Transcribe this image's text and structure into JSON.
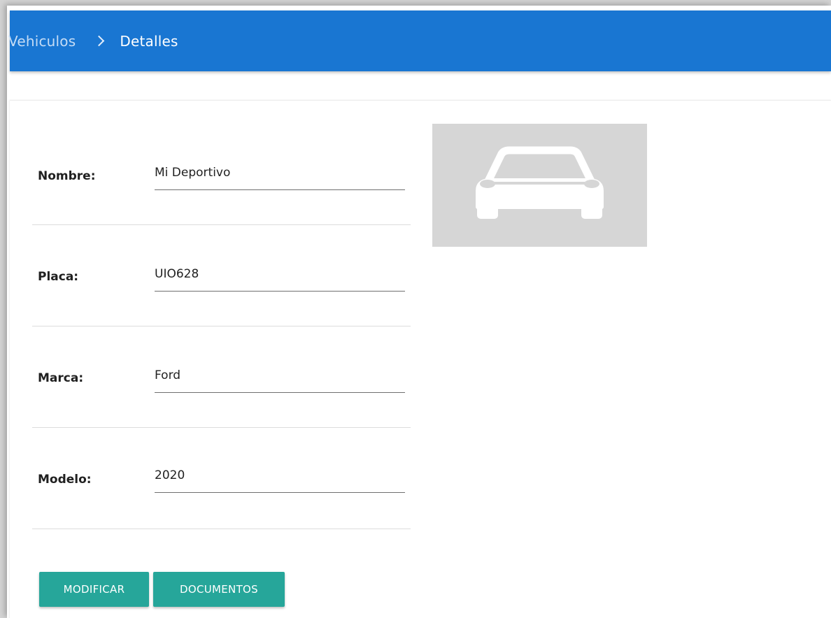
{
  "breadcrumb": {
    "parent": "Vehiculos",
    "current": "Detalles"
  },
  "fields": [
    {
      "label": "Nombre:",
      "value": "Mi Deportivo"
    },
    {
      "label": "Placa:",
      "value": "UIO628"
    },
    {
      "label": "Marca:",
      "value": "Ford"
    },
    {
      "label": "Modelo:",
      "value": "2020"
    }
  ],
  "photo": {
    "icon": "car-icon"
  },
  "actions": {
    "modify_label": "MODIFICAR",
    "documents_label": "DOCUMENTOS"
  },
  "colors": {
    "primary": "#1976d2",
    "accent": "#26a69a",
    "placeholder_bg": "#d6d6d6"
  }
}
